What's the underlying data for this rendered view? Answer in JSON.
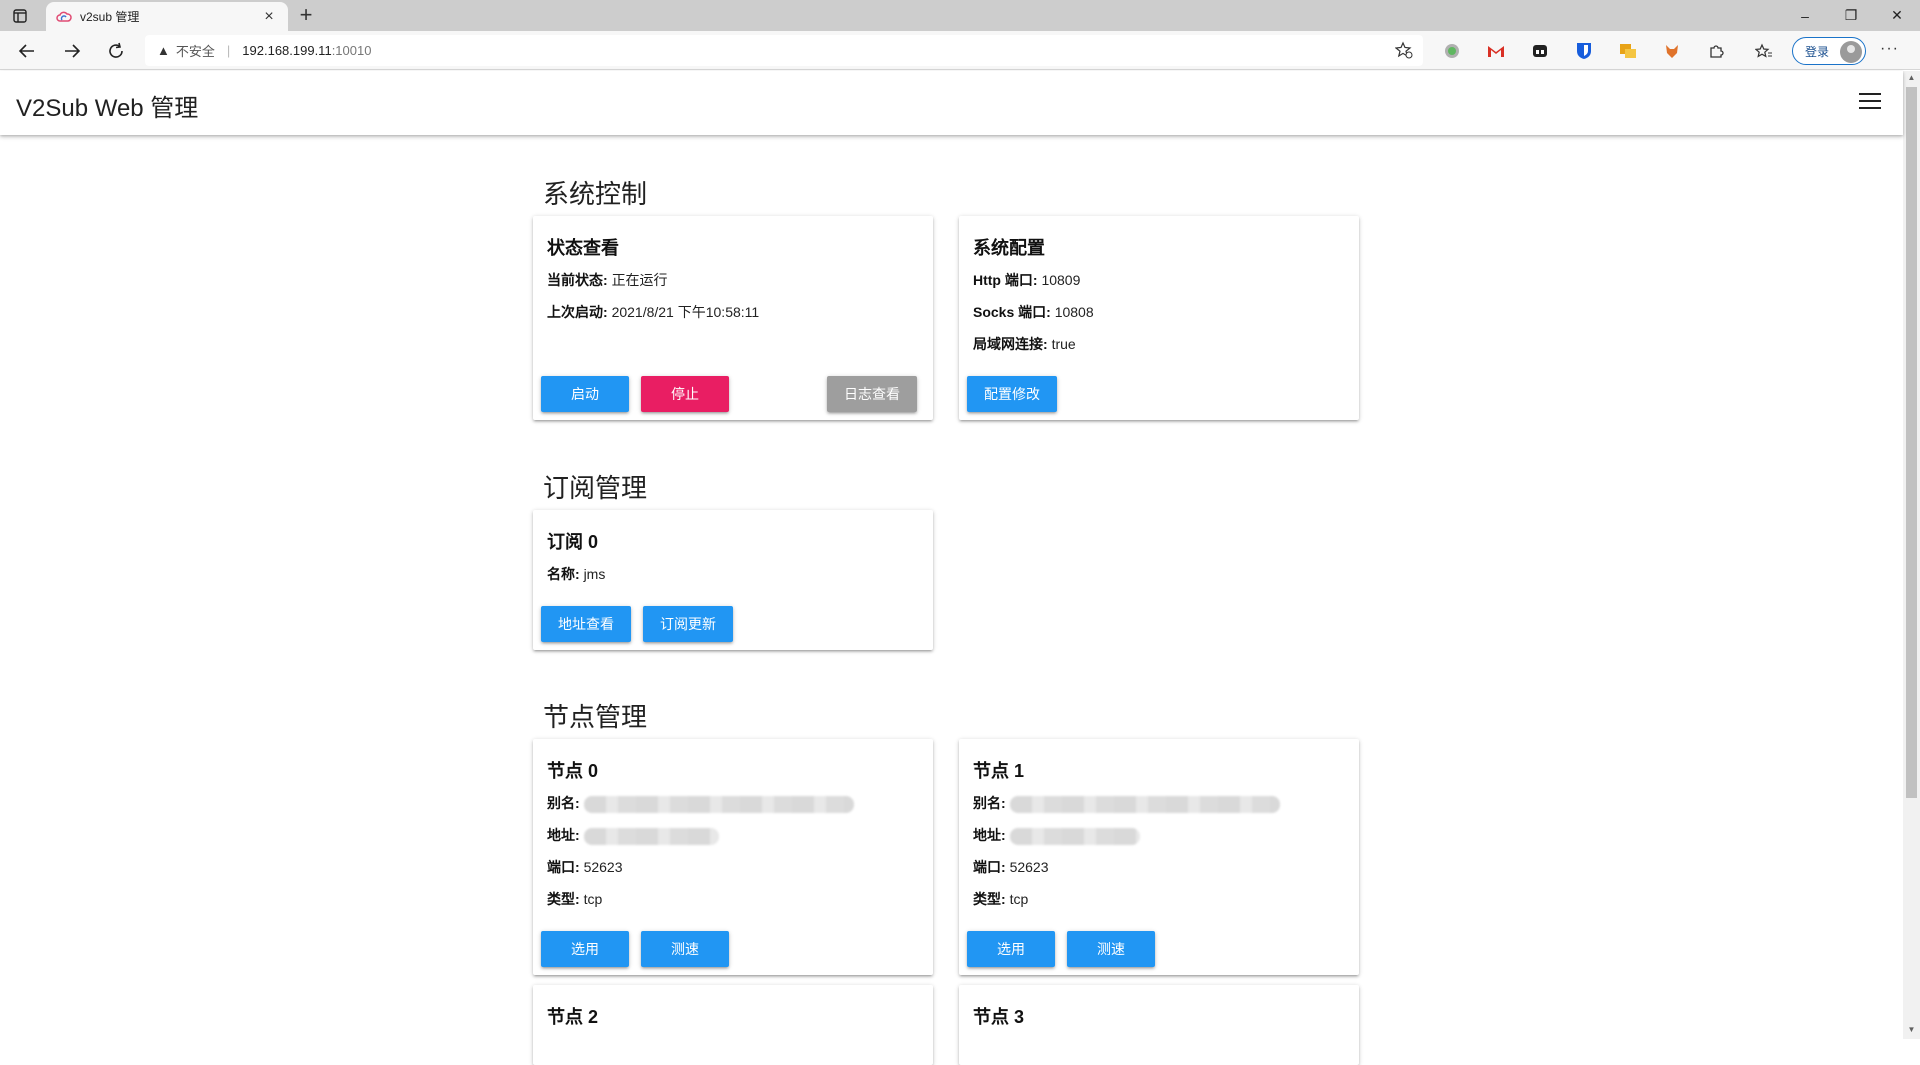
{
  "colors": {
    "primary": "#2196f3",
    "danger": "#e91e63",
    "neutral": "#9e9e9e",
    "tabbar": "#cdcdcd",
    "toolbar": "#f7f7f7"
  },
  "browser": {
    "tab_title": "v2sub 管理",
    "tab_close": "×",
    "new_tab": "+",
    "window_controls": [
      "–",
      "❐",
      "✕"
    ],
    "insecure_label": "不安全",
    "url_host": "192.168.199.11",
    "url_port": ":10010",
    "login_label": "登录",
    "more": "···",
    "extensions": [
      "green-circle-icon",
      "gmail-icon",
      "reader-icon",
      "bitwarden-icon",
      "translate-icon",
      "fox-icon",
      "extensions-icon",
      "favorites-icon"
    ]
  },
  "app": {
    "title": "V2Sub Web 管理"
  },
  "system": {
    "section_title": "系统控制",
    "status_card": {
      "title": "状态查看",
      "state_label": "当前状态:",
      "state_value": "正在运行",
      "last_start_label": "上次启动:",
      "last_start_value": "2021/8/21 下午10:58:11",
      "start_btn": "启动",
      "stop_btn": "停止",
      "log_btn": "日志查看"
    },
    "config_card": {
      "title": "系统配置",
      "http_label": "Http 端口:",
      "http_value": "10809",
      "socks_label": "Socks 端口:",
      "socks_value": "10808",
      "lan_label": "局域网连接:",
      "lan_value": "true",
      "edit_btn": "配置修改"
    }
  },
  "subscriptions": {
    "section_title": "订阅管理",
    "items": [
      {
        "title": "订阅 0",
        "name_label": "名称:",
        "name_value": "jms",
        "view_btn": "地址查看",
        "update_btn": "订阅更新"
      }
    ]
  },
  "nodes": {
    "section_title": "节点管理",
    "alias_label": "别名:",
    "address_label": "地址:",
    "port_label": "端口:",
    "type_label": "类型:",
    "select_btn": "选用",
    "speed_btn": "测速",
    "items": [
      {
        "title": "节点 0",
        "port": "52623",
        "type": "tcp"
      },
      {
        "title": "节点 1",
        "port": "52623",
        "type": "tcp"
      },
      {
        "title": "节点 2"
      },
      {
        "title": "节点 3"
      }
    ]
  }
}
